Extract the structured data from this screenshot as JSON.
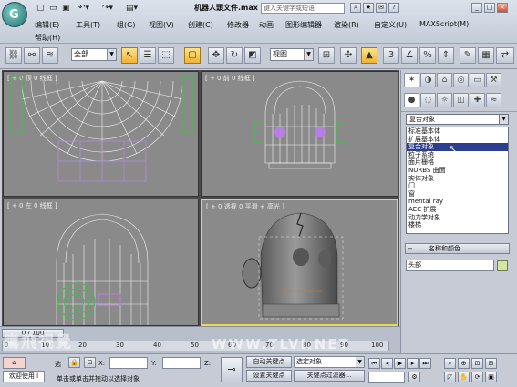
{
  "app": {
    "file_title": "机器人頭文件.max",
    "search_placeholder": "键入关键字或短语"
  },
  "menu": [
    "编辑(E)",
    "工具(T)",
    "组(G)",
    "视图(V)",
    "创建(C)",
    "修改器",
    "动画",
    "图形编辑器",
    "渲染(R)",
    "自定义(U)",
    "MAXScript(M)",
    "帮助(H)"
  ],
  "toolbar": {
    "selection_filter": "全部",
    "coord_system": "视图"
  },
  "viewports": [
    {
      "label": "[ + 0 顶 0 线框 ]"
    },
    {
      "label": "[ + 0 前 0 线框 ]"
    },
    {
      "label": "[ + 0 左 0 线框 ]"
    },
    {
      "label": "[ + 0 透视 0 平滑 + 高光 ]"
    }
  ],
  "command_panel": {
    "dropdown_value": "复合对象",
    "list_items": [
      "标准基本体",
      "扩展基本体",
      "复合对象",
      "粒子系统",
      "面片栅格",
      "NURBS 曲面",
      "实体对象",
      "门",
      "窗",
      "mental ray",
      "AEC 扩展",
      "动力学对象",
      "楼梯"
    ],
    "selected_index": 2,
    "rollout_title": "名称和颜色",
    "object_name": "头部",
    "object_color": "#d3e7a0"
  },
  "time": {
    "frame_counter": "0 / 100",
    "ticks": [
      "0",
      "10",
      "20",
      "30",
      "40",
      "50",
      "60",
      "70",
      "80",
      "90",
      "100"
    ]
  },
  "status": {
    "welcome": "欢迎使用 l",
    "selected": "选",
    "x_label": "X:",
    "y_label": "Y:",
    "z_label": "Z:",
    "prompt": "单击或单击并拖动以选择对象",
    "auto_key": "自动关键点",
    "set_key": "设置关键点",
    "key_filter_value": "选定对象",
    "key_filters": "关键点过滤器..."
  },
  "watermark": {
    "left": "鷹飛視覺",
    "right": "WWW.TLVI.NET"
  }
}
